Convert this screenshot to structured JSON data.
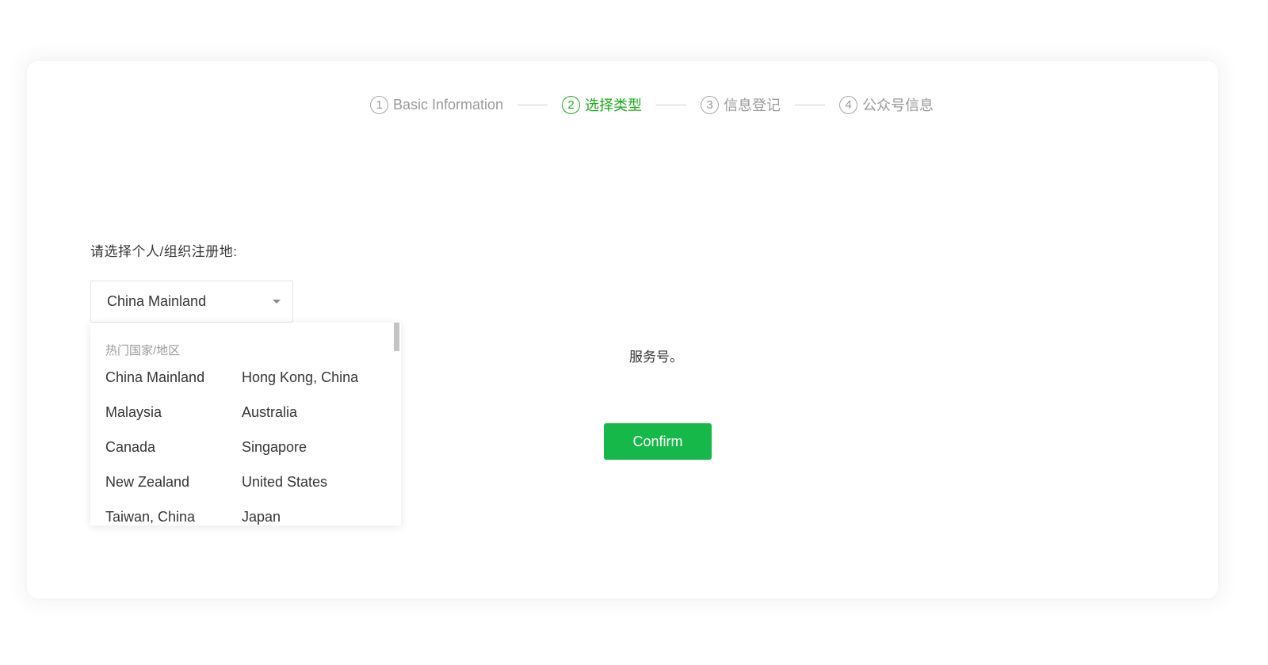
{
  "steps": [
    {
      "number": "1",
      "label": "Basic Information",
      "state": "done"
    },
    {
      "number": "2",
      "label": "选择类型",
      "state": "active"
    },
    {
      "number": "3",
      "label": "信息登记",
      "state": "pending"
    },
    {
      "number": "4",
      "label": "公众号信息",
      "state": "pending"
    }
  ],
  "form": {
    "prompt": "请选择个人/组织注册地:",
    "select": {
      "selected_value": "China Mainland"
    },
    "hint_visible_tail": "服务号。",
    "confirm_label": "Confirm"
  },
  "dropdown": {
    "group_title": "热门国家/地区",
    "options": [
      "China Mainland",
      "Hong Kong, China",
      "Malaysia",
      "Australia",
      "Canada",
      "Singapore",
      "New Zealand",
      "United States",
      "Taiwan, China",
      "Japan"
    ]
  },
  "colors": {
    "accent_green": "#1aad19",
    "button_green": "#17b84a",
    "muted_text": "#9a9a9a",
    "text": "#353535"
  }
}
